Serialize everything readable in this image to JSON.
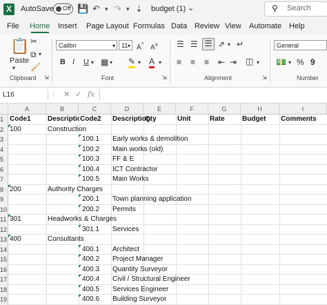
{
  "titlebar": {
    "autosave_label": "AutoSave",
    "toggle_state": "Off",
    "filename": "budget (1)",
    "search_placeholder": "Search"
  },
  "menu": [
    "File",
    "Home",
    "Insert",
    "Page Layout",
    "Formulas",
    "Data",
    "Review",
    "View",
    "Automate",
    "Help"
  ],
  "ribbon": {
    "paste_label": "Paste",
    "clipboard_label": "Clipboard",
    "font_name": "Calibri",
    "font_size": "11",
    "font_group_label": "Font",
    "alignment_label": "Alignment",
    "number_format": "General",
    "number_label": "Number",
    "accent_color": "#1d6f42"
  },
  "formula_bar": {
    "name_box": "L16",
    "fx": "fx"
  },
  "columns": [
    "A",
    "B",
    "C",
    "D",
    "E",
    "F",
    "G",
    "H",
    "I"
  ],
  "headers": {
    "A": "Code1",
    "B": "Description",
    "C": "Code2",
    "D": "Description",
    "E": "Qty",
    "F": "Unit",
    "G": "Rate",
    "H": "Budget",
    "I": "Comments"
  },
  "rows": [
    {
      "n": "1"
    },
    {
      "n": "2",
      "A": "100",
      "B": "Construction"
    },
    {
      "n": "3",
      "C": "100.1",
      "D": "Early works & demolition"
    },
    {
      "n": "4",
      "C": "100.2",
      "D": "Main works (old)"
    },
    {
      "n": "5",
      "C": "100.3",
      "D": "FF & E"
    },
    {
      "n": "6",
      "C": "100.4",
      "D": "ICT Contractor"
    },
    {
      "n": "7",
      "C": "100.5",
      "D": "Main Works"
    },
    {
      "n": "8",
      "A": "200",
      "B": "Authority Charges"
    },
    {
      "n": "9",
      "C": "200.1",
      "D": "Town planning application"
    },
    {
      "n": "10",
      "C": "200.2",
      "D": "Permits"
    },
    {
      "n": "11",
      "A": "301",
      "B": "Headworks & Charges"
    },
    {
      "n": "12",
      "C": "301.1",
      "D": "Services"
    },
    {
      "n": "13",
      "A": "400",
      "B": "Consultants"
    },
    {
      "n": "14",
      "C": "400.1",
      "D": "Architect"
    },
    {
      "n": "15",
      "C": "400.2",
      "D": "Project Manager"
    },
    {
      "n": "16",
      "C": "400.3",
      "D": "Quantity Surveyor"
    },
    {
      "n": "17",
      "C": "400.4",
      "D": "Civil / Structural Engineer"
    },
    {
      "n": "18",
      "C": "400.5",
      "D": "Services Engineer"
    },
    {
      "n": "19",
      "C": "400.6",
      "D": "Building Surveyor"
    }
  ]
}
